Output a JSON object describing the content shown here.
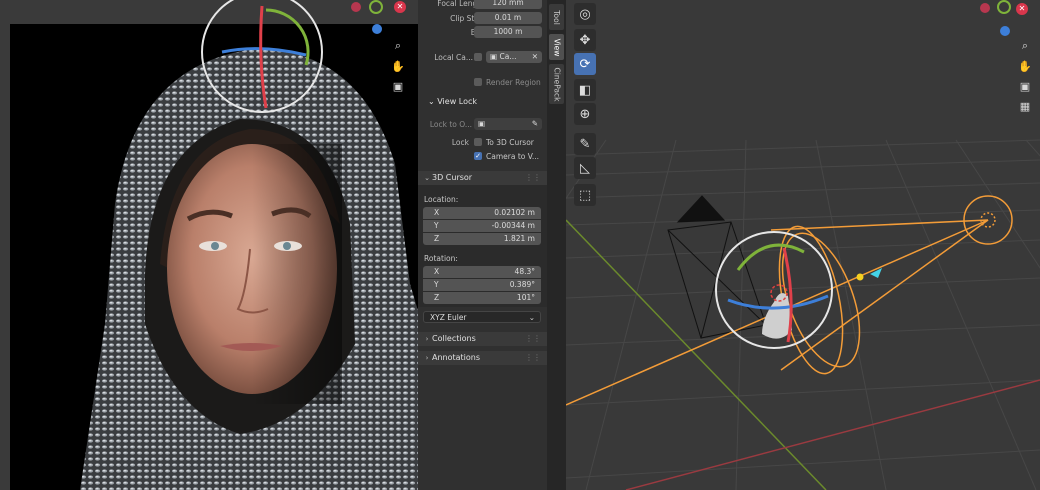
{
  "n_panel": {
    "focal_length": {
      "label": "Focal Length",
      "value": "120 mm"
    },
    "clip_start": {
      "label": "Clip Start",
      "value": "0.01 m"
    },
    "clip_end": {
      "label": "End",
      "value": "1000 m"
    },
    "local_camera": {
      "label": "Local Ca...",
      "value": "Ca..."
    },
    "render_region": {
      "label": "Render Region"
    },
    "view_lock": {
      "header": "View Lock",
      "lock_to_object": {
        "label": "Lock to O..."
      },
      "lock_label": "Lock",
      "to_3d_cursor": {
        "label": "To 3D Cursor",
        "checked": false
      },
      "camera_to_view": {
        "label": "Camera to V...",
        "checked": true
      }
    },
    "cursor": {
      "header": "3D Cursor",
      "location_label": "Location:",
      "location": [
        {
          "axis": "X",
          "value": "0.02102 m"
        },
        {
          "axis": "Y",
          "value": "-0.00344 m"
        },
        {
          "axis": "Z",
          "value": "1.821 m"
        }
      ],
      "rotation_label": "Rotation:",
      "rotation": [
        {
          "axis": "X",
          "value": "48.3°"
        },
        {
          "axis": "Y",
          "value": "0.389°"
        },
        {
          "axis": "Z",
          "value": "101°"
        }
      ],
      "rotation_mode": "XYZ Euler"
    },
    "collections": {
      "header": "Collections"
    },
    "annotations": {
      "header": "Annotations"
    }
  },
  "side_tabs": [
    "Tool",
    "View",
    "CinePack"
  ],
  "active_tab": "View",
  "toolbar": [
    "select-cursor-icon",
    "move-icon",
    "rotate-icon",
    "scale-icon",
    "transform-icon",
    "annotate-icon",
    "measure-icon",
    "add-cube-icon"
  ],
  "colors": {
    "accent": "#4772b3",
    "axis_x": "#e0404a",
    "axis_y": "#7fb33a",
    "axis_z": "#3d7fd9",
    "selection_orange": "#f39c38"
  }
}
